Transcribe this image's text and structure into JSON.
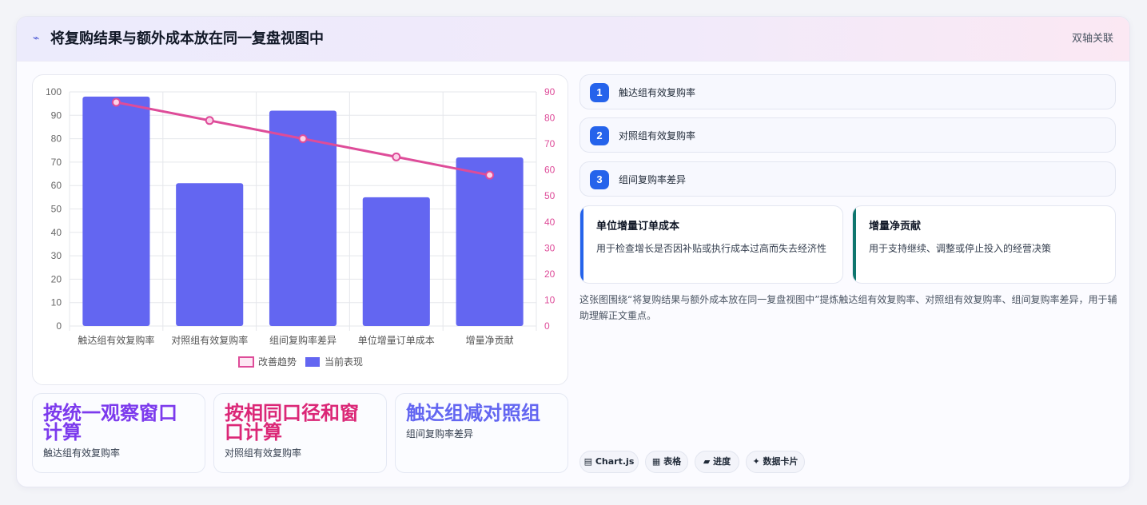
{
  "header": {
    "icon": "sparkline-icon",
    "title": "将复购结果与额外成本放在同一复盘视图中",
    "tag": "双轴关联"
  },
  "chart_data": {
    "type": "bar",
    "categories": [
      "触达组有效复购率",
      "对照组有效复购率",
      "组间复购率差异",
      "单位增量订单成本",
      "增量净贡献"
    ],
    "series": [
      {
        "name": "当前表现",
        "type": "bar",
        "axis": "left",
        "color": "#6366f1",
        "values": [
          98,
          61,
          92,
          55,
          72
        ]
      },
      {
        "name": "改善趋势",
        "type": "line",
        "axis": "right",
        "color": "#de4c99",
        "values": [
          86,
          79,
          72,
          65,
          58
        ]
      }
    ],
    "ylim_left": [
      0,
      100
    ],
    "yticks_left": [
      0,
      10,
      20,
      30,
      40,
      50,
      60,
      70,
      80,
      90,
      100
    ],
    "ylim_right": [
      0,
      90
    ],
    "yticks_right": [
      0,
      10,
      20,
      30,
      40,
      50,
      60,
      70,
      80,
      90
    ],
    "grid": true,
    "legend": "bottom",
    "legend_items": [
      "改善趋势",
      "当前表现"
    ]
  },
  "kpis": [
    {
      "value": "按统一观察窗口计算",
      "label": "触达组有效复购率",
      "color": "#7c3aed"
    },
    {
      "value": "按相同口径和窗口计算",
      "label": "对照组有效复购率",
      "color": "#db2777"
    },
    {
      "value": "触达组减对照组",
      "label": "组间复购率差异",
      "color": "#6366f1"
    }
  ],
  "steps": [
    {
      "num": "1",
      "label": "触达组有效复购率"
    },
    {
      "num": "2",
      "label": "对照组有效复购率"
    },
    {
      "num": "3",
      "label": "组间复购率差异"
    }
  ],
  "info_cards": [
    {
      "title": "单位增量订单成本",
      "desc": "用于检查增长是否因补贴或执行成本过高而失去经济性",
      "accent": "#2563eb"
    },
    {
      "title": "增量净贡献",
      "desc": "用于支持继续、调整或停止投入的经营决策",
      "accent": "#0f766e"
    }
  ],
  "summary": "这张图围绕“将复购结果与额外成本放在同一复盘视图中”提炼触达组有效复购率、对照组有效复购率、组间复购率差异，用于辅助理解正文重点。",
  "chips": [
    {
      "icon": "chart-icon",
      "glyph": "▤",
      "label": "Chart.js"
    },
    {
      "icon": "table-icon",
      "glyph": "▦",
      "label": "表格"
    },
    {
      "icon": "progress-icon",
      "glyph": "▰",
      "label": "进度"
    },
    {
      "icon": "data-card-icon",
      "glyph": "✦",
      "label": "数据卡片"
    }
  ]
}
